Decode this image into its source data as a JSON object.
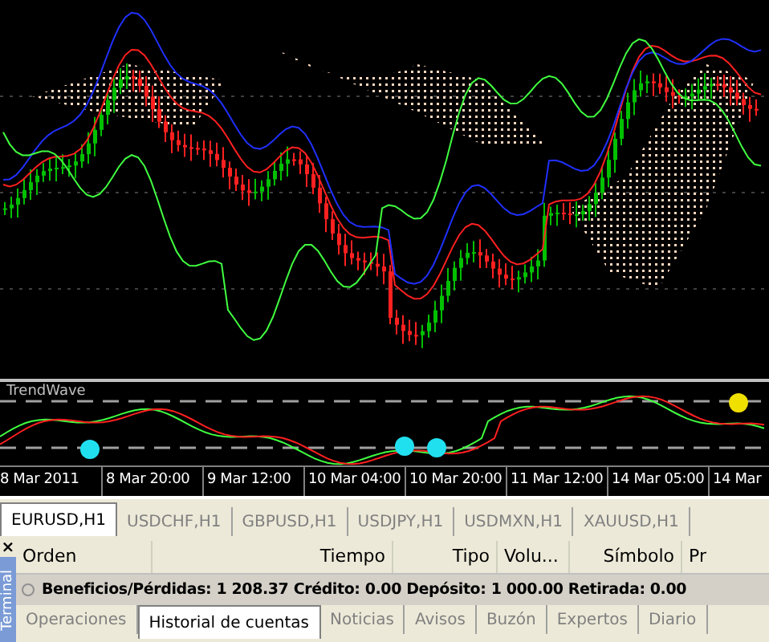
{
  "indicator": {
    "title": "TrendWave"
  },
  "time_axis": [
    "8 Mar 2011",
    "8 Mar 20:00",
    "9 Mar 12:00",
    "10 Mar 04:00",
    "10 Mar 20:00",
    "11 Mar 12:00",
    "14 Mar 05:00",
    "14 Mar"
  ],
  "chart_tabs": [
    {
      "label": "EURUSD,H1",
      "selected": true
    },
    {
      "label": "USDCHF,H1",
      "selected": false
    },
    {
      "label": "GBPUSD,H1",
      "selected": false
    },
    {
      "label": "USDJPY,H1",
      "selected": false
    },
    {
      "label": "USDMXN,H1",
      "selected": false
    },
    {
      "label": "XAUUSD,H1",
      "selected": false
    }
  ],
  "terminal": {
    "title": "Terminal",
    "close": "×",
    "columns": [
      "Orden",
      "Tiempo",
      "Tipo",
      "Volu...",
      "Símbolo",
      "Pr"
    ],
    "summary": "Beneficios/Pérdidas: 1 208.37  Crédito: 0.00  Depósito: 1 000.00  Retirada: 0.00",
    "tabs": [
      {
        "label": "Operaciones",
        "selected": false
      },
      {
        "label": "Historial de cuentas",
        "selected": true
      },
      {
        "label": "Noticias",
        "selected": false
      },
      {
        "label": "Avisos",
        "selected": false
      },
      {
        "label": "Buzón",
        "selected": false
      },
      {
        "label": "Expertos",
        "selected": false
      },
      {
        "label": "Diario",
        "selected": false
      }
    ]
  }
}
